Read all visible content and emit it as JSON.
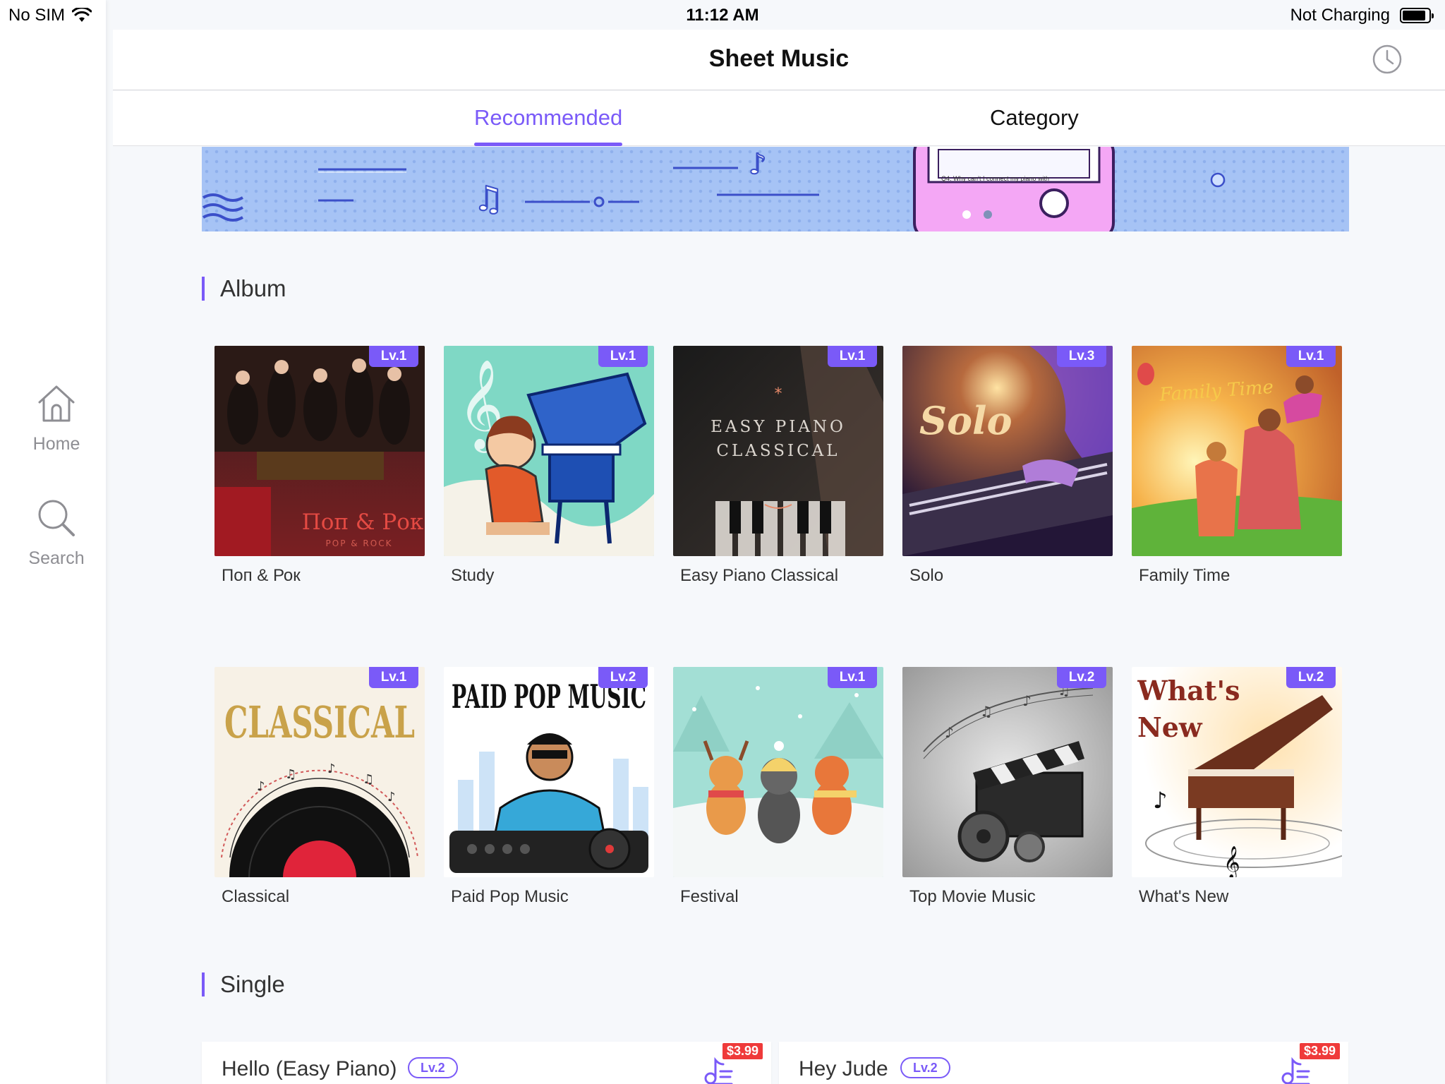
{
  "status_bar": {
    "carrier": "No SIM",
    "time": "11:12 AM",
    "battery_text": "Not Charging",
    "battery_level": 0.9
  },
  "sidebar": {
    "items": [
      {
        "label": "Home",
        "icon": "home-icon"
      },
      {
        "label": "Search",
        "icon": "search-icon"
      }
    ]
  },
  "header": {
    "title": "Sheet Music",
    "history_icon": "clock-icon"
  },
  "tabs": [
    {
      "label": "Recommended",
      "active": true
    },
    {
      "label": "Category",
      "active": false
    }
  ],
  "banner": {
    "phone_text": "Q4. Why can’t I connect my piano with",
    "page_count": 2,
    "active_page": 0
  },
  "album_section": {
    "title": "Album",
    "items": [
      {
        "name": "Поп & Рок",
        "level": "Lv.1",
        "cover_text": "Поп & Рок",
        "cover_sub": "POP & ROCK"
      },
      {
        "name": "Study",
        "level": "Lv.1"
      },
      {
        "name": "Easy Piano Classical",
        "level": "Lv.1",
        "cover_text": "EASY PIANO CLASSICAL"
      },
      {
        "name": "Solo",
        "level": "Lv.3",
        "cover_text": "Solo"
      },
      {
        "name": "Family Time",
        "level": "Lv.1",
        "cover_text": "Family Time"
      },
      {
        "name": "Classical",
        "level": "Lv.1",
        "cover_text": "CLASSICAL"
      },
      {
        "name": "Paid Pop Music",
        "level": "Lv.2",
        "cover_text": "PAID POP MUSIC"
      },
      {
        "name": "Festival",
        "level": "Lv.1"
      },
      {
        "name": "Top Movie Music",
        "level": "Lv.2"
      },
      {
        "name": "What's New",
        "level": "Lv.2",
        "cover_text": "What's New"
      }
    ]
  },
  "single_section": {
    "title": "Single",
    "items": [
      {
        "name": "Hello (Easy Piano)",
        "level": "Lv.2",
        "price": "$3.99"
      },
      {
        "name": "Hey Jude",
        "level": "Lv.2",
        "price": "$3.99"
      }
    ]
  },
  "colors": {
    "accent": "#7a5af8",
    "price_red": "#ef3a3a",
    "banner_blue": "#a6c3f5"
  }
}
